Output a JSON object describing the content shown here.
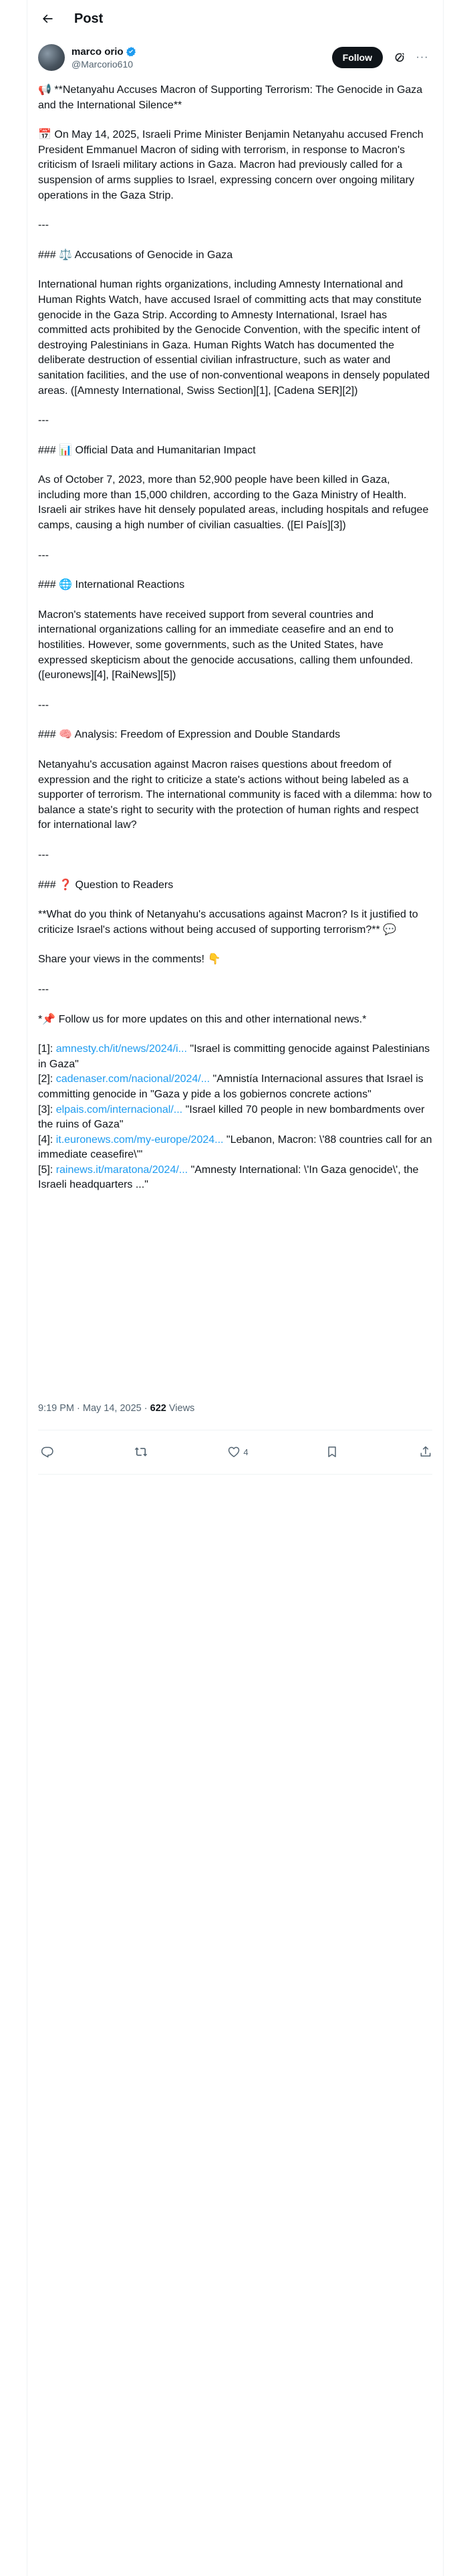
{
  "header": {
    "title": "Post"
  },
  "author": {
    "name": "marco orio",
    "handle": "@Marcorio610",
    "follow_label": "Follow",
    "more_label": "···"
  },
  "post": {
    "paragraphs": [
      "📢 **Netanyahu Accuses Macron of Supporting Terrorism: The Genocide in Gaza and the International Silence**",
      "📅 On May 14, 2025, Israeli Prime Minister Benjamin Netanyahu accused French President Emmanuel Macron of siding with terrorism, in response to Macron's criticism of Israeli military actions in Gaza. Macron had previously called for a suspension of arms supplies to Israel, expressing concern over ongoing military operations in the Gaza Strip.",
      "---",
      "### ⚖️ Accusations of Genocide in Gaza",
      "International human rights organizations, including Amnesty International and Human Rights Watch, have accused Israel of committing acts that may constitute genocide in the Gaza Strip. According to Amnesty International, Israel has committed acts prohibited by the Genocide Convention, with the specific intent of destroying Palestinians in Gaza. Human Rights Watch has documented the deliberate destruction of essential civilian infrastructure, such as water and sanitation facilities, and the use of non-conventional weapons in densely populated areas. ([Amnesty International, Swiss Section][1], [Cadena SER][2])",
      "---",
      "### 📊 Official Data and Humanitarian Impact",
      "As of October 7, 2023, more than 52,900 people have been killed in Gaza, including more than 15,000 children, according to the Gaza Ministry of Health. Israeli air strikes have hit densely populated areas, including hospitals and refugee camps, causing a high number of civilian casualties. ([El País][3])",
      "---",
      "### 🌐 International Reactions",
      "Macron's statements have received support from several countries and international organizations calling for an immediate ceasefire and an end to hostilities. However, some governments, such as the United States, have expressed skepticism about the genocide accusations, calling them unfounded. ([euronews][4], [RaiNews][5])",
      "---",
      "### 🧠 Analysis: Freedom of Expression and Double Standards",
      "Netanyahu's accusation against Macron raises questions about freedom of expression and the right to criticize a state's actions without being labeled as a supporter of terrorism. The international community is faced with a dilemma: how to balance a state's right to security with the protection of human rights and respect for international law?",
      "---",
      "### ❓ Question to Readers",
      "**What do you think of Netanyahu's accusations against Macron? Is it justified to criticize Israel's actions without being accused of supporting terrorism?** 💬",
      "Share your views in the comments! 👇",
      "---",
      "*📌 Follow us for more updates on this and other international news.*"
    ],
    "refs": [
      {
        "prefix": "[1]: ",
        "url": "amnesty.ch/it/news/2024/i...",
        "text": " \"Israel is committing genocide against Palestinians in Gaza\""
      },
      {
        "prefix": "[2]: ",
        "url": "cadenaser.com/nacional/2024/...",
        "text": " \"Amnistía Internacional assures that Israel is committing genocide in \"Gaza y pide a los gobiernos concrete actions\""
      },
      {
        "prefix": "[3]: ",
        "url": "elpais.com/internacional/...",
        "text": " \"Israel killed 70 people in new bombardments over the ruins of Gaza\""
      },
      {
        "prefix": "[4]: ",
        "url": "it.euronews.com/my-europe/2024...",
        "text": " \"Lebanon, Macron: \\'88 countries call for an immediate ceasefire\\'\""
      },
      {
        "prefix": "[5]: ",
        "url": "rainews.it/maratona/2024/...",
        "text": " \"Amnesty International: \\'In Gaza genocide\\', the Israeli headquarters ...\""
      }
    ],
    "timestamp": "9:19 PM · May 14, 2025 · ",
    "views_count": "622",
    "views_label": " Views"
  },
  "actions": {
    "reply_count": "",
    "repost_count": "",
    "like_count": "4",
    "bookmark_count": ""
  },
  "icons": {
    "back": "arrow-left-icon",
    "verified": "verified-badge-icon",
    "grok": "grok-icon",
    "more": "more-icon",
    "reply": "reply-icon",
    "repost": "repost-icon",
    "like": "heart-icon",
    "bookmark": "bookmark-icon",
    "share": "share-icon"
  },
  "colors": {
    "accent": "#1d9bf0",
    "text": "#0f1419",
    "muted": "#536471",
    "verified": "#1d9bf0"
  }
}
